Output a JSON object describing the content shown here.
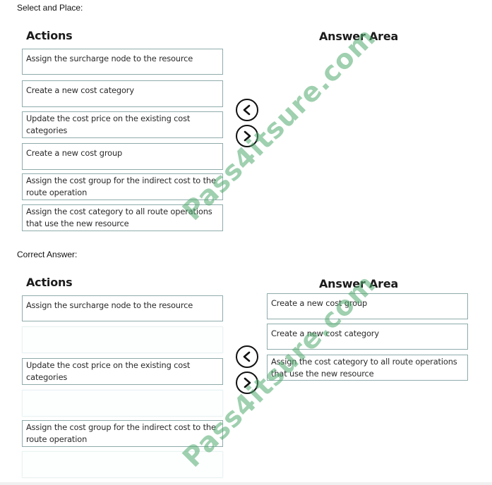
{
  "question": {
    "label": "Select and Place:",
    "actions_heading": "Actions",
    "answer_heading": "Answer Area",
    "actions": [
      "Assign the surcharge node to the resource",
      "Create a new cost category",
      "Update the cost price on the existing cost categories",
      "Create a new cost group",
      "Assign the cost group for the indirect cost to the route operation",
      "Assign the cost category to all route operations that use the new resource"
    ],
    "answer_area": []
  },
  "correct_answer": {
    "label": "Correct Answer:",
    "actions_heading": "Actions",
    "answer_heading": "Answer Area",
    "actions": [
      "Assign the surcharge node to the resource",
      "",
      "Update the cost price on the existing cost categories",
      "",
      "Assign the cost group for the indirect cost to the route operation",
      ""
    ],
    "answer_area": [
      "Create a new cost group",
      "Create a new cost category",
      "Assign the cost category to all route operations that use the new resource"
    ]
  },
  "controls": {
    "move_left_icon": "chevron-left-circle",
    "move_right_icon": "chevron-right-circle"
  },
  "watermark": "Pass4itsure.com"
}
